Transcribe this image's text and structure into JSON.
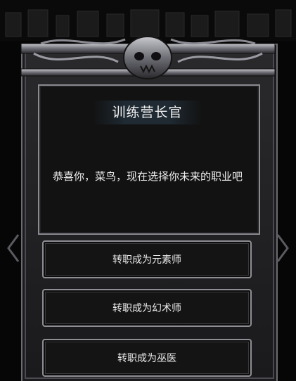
{
  "npc": {
    "title": "训练营长官"
  },
  "dialog": {
    "text": "恭喜你，菜鸟，现在选择你未来的职业吧"
  },
  "choices": [
    {
      "label": "转职成为元素师"
    },
    {
      "label": "转职成为幻术师"
    },
    {
      "label": "转职成为巫医"
    }
  ],
  "icons": {
    "left": "chevron-left-icon",
    "right": "chevron-right-icon",
    "crest": "skull-crest-icon"
  },
  "colors": {
    "frame": "#6a6a70",
    "panel": "#121212",
    "background": "#060606"
  }
}
